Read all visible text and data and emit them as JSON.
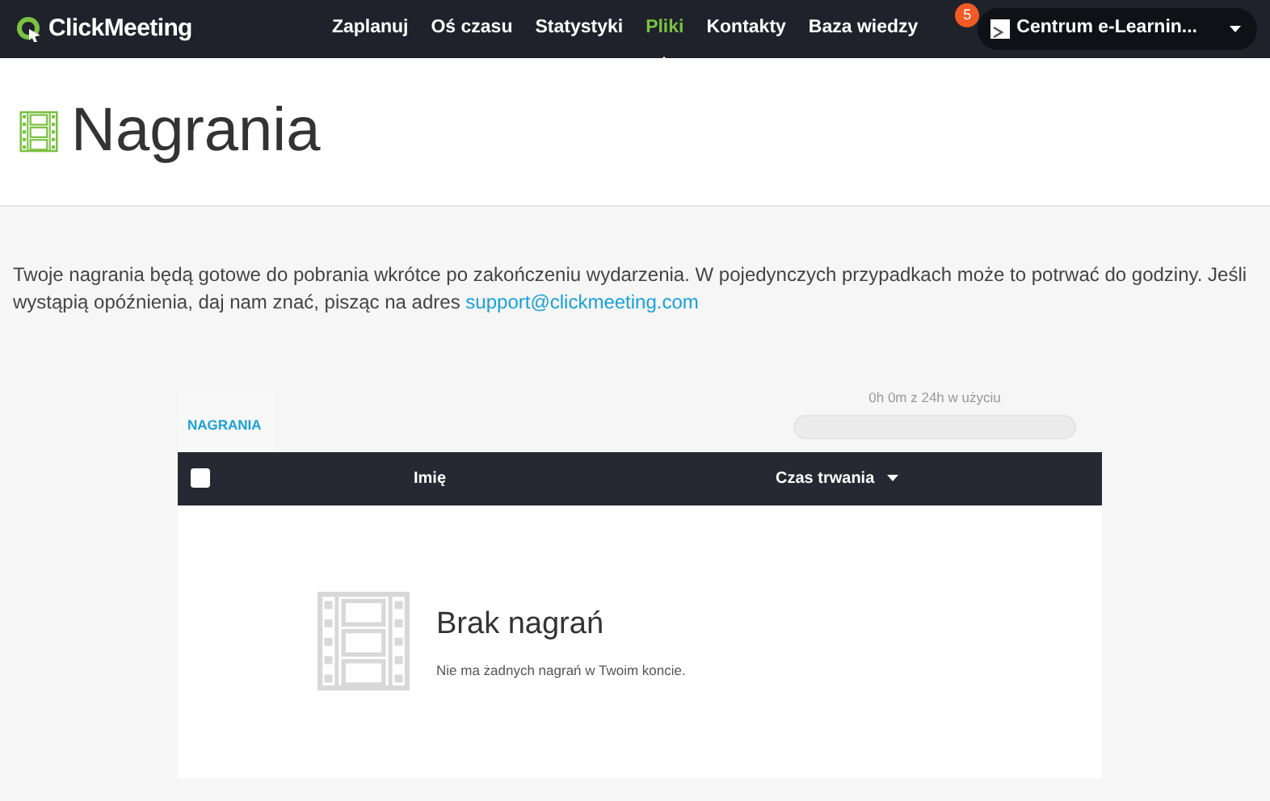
{
  "brand": {
    "name": "ClickMeeting"
  },
  "nav": [
    {
      "label": "Zaplanuj",
      "selected": false
    },
    {
      "label": "Oś czasu",
      "selected": false
    },
    {
      "label": "Statystyki",
      "selected": false
    },
    {
      "label": "Pliki",
      "selected": true
    },
    {
      "label": "Kontakty",
      "selected": false
    },
    {
      "label": "Baza wiedzy",
      "selected": false
    }
  ],
  "account": {
    "badge": "5",
    "name": "Centrum e-Learnin..."
  },
  "page_title": "Nagrania",
  "info": {
    "text": "Twoje nagrania będą gotowe do pobrania wkrótce po zakończeniu wydarzenia. W pojedynczych przypadkach może to potrwać do godziny. Jeśli wystąpią opóźnienia, daj nam znać, pisząc na adres ",
    "link": "support@clickmeeting.com"
  },
  "tabs": [
    {
      "label": "NAGRANIA",
      "selected": true
    }
  ],
  "usage": {
    "label": "0h 0m z 24h w użyciu",
    "level": 0
  },
  "table": {
    "select_all_checked": false,
    "columns": [
      {
        "label": "Imię",
        "sorted": false
      },
      {
        "label": "Czas trwania",
        "sorted": true
      }
    ]
  },
  "empty": {
    "title": "Brak nagrań",
    "text": "Nie ma żadnych nagrań w Twoim koncie."
  }
}
